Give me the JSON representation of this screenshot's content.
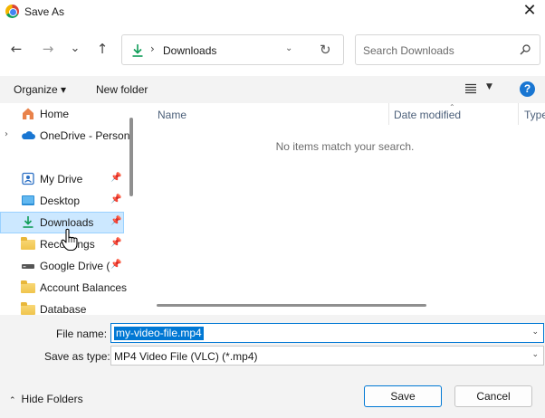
{
  "window": {
    "title": "Save As",
    "close_glyph": "✕"
  },
  "nav": {
    "back_glyph": "←",
    "forward_glyph": "→",
    "recent_glyph": "⌄",
    "up_glyph": "↑",
    "address": {
      "separator": "›",
      "location": "Downloads",
      "dropdown_glyph": "⌄",
      "refresh_glyph": "↻"
    },
    "search_placeholder": "Search Downloads"
  },
  "commandbar": {
    "organize_label": "Organize ▾",
    "new_folder_label": "New folder",
    "view_dropdown_glyph": "▼",
    "help_glyph": "?"
  },
  "sidebar": {
    "items": [
      {
        "label": "Home",
        "icon": "home-icon"
      },
      {
        "label": "OneDrive - Personal",
        "icon": "onedrive-icon",
        "expander": "›"
      },
      {
        "label": "My Drive",
        "icon": "my-drive-icon",
        "pinned": true
      },
      {
        "label": "Desktop",
        "icon": "desktop-icon",
        "pinned": true
      },
      {
        "label": "Downloads",
        "icon": "downloads-icon",
        "pinned": true,
        "selected": true
      },
      {
        "label": "Recordings",
        "icon": "folder-icon",
        "pinned": true
      },
      {
        "label": "Google Drive (",
        "icon": "drive-icon",
        "pinned": true
      },
      {
        "label": "Account Balances",
        "icon": "folder-icon"
      },
      {
        "label": "Database",
        "icon": "folder-icon"
      }
    ],
    "pin_glyph": "📌"
  },
  "filelist": {
    "columns": [
      "Name",
      "Date modified",
      "Type"
    ],
    "sort_glyph": "⌃",
    "empty_message": "No items match your search."
  },
  "form": {
    "filename_label": "File name:",
    "filename_value": "my-video-file.mp4",
    "savetype_label": "Save as type:",
    "savetype_value": "MP4 Video File (VLC) (*.mp4)",
    "dropdown_glyph": "⌄"
  },
  "footer": {
    "hide_folders_glyph": "⌃",
    "hide_folders_label": "Hide Folders",
    "save_label": "Save",
    "cancel_label": "Cancel"
  },
  "colors": {
    "accent": "#0078d4",
    "selection_bg": "#cce8ff",
    "chrome_bg": "#f3f3f3"
  }
}
